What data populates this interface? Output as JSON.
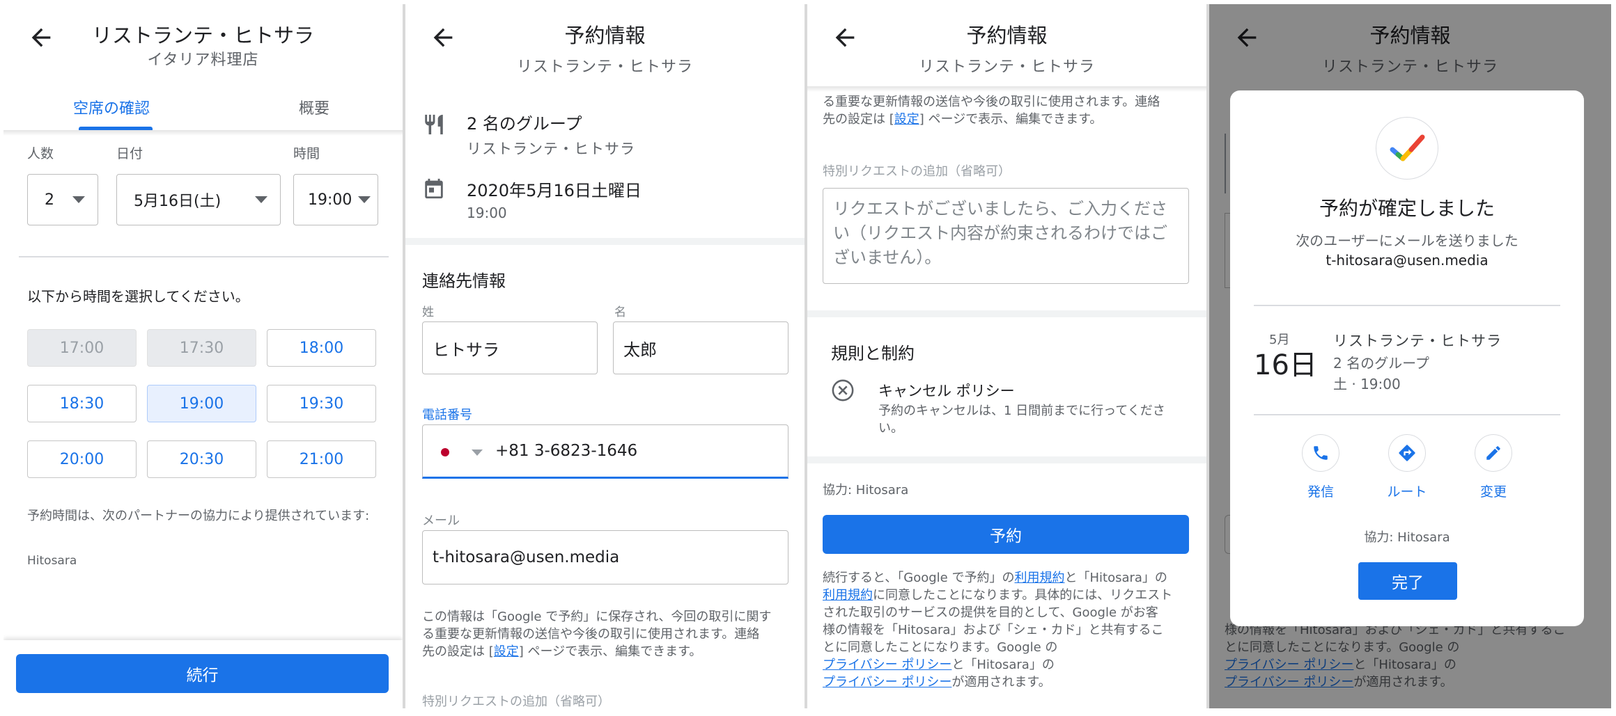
{
  "p1": {
    "title": "リストランテ・ヒトサラ",
    "subtitle": "イタリア料理店",
    "tabs": [
      "空席の確認",
      "概要"
    ],
    "labels": {
      "party": "人数",
      "date": "日付",
      "time": "時間"
    },
    "party_value": "2",
    "date_value": "5月16日(土)",
    "time_value": "19:00",
    "prompt": "以下から時間を選択してください。",
    "slots": [
      "17:00",
      "17:30",
      "18:00",
      "18:30",
      "19:00",
      "19:30",
      "20:00",
      "20:30",
      "21:00"
    ],
    "partner_note": "予約時間は、次のパートナーの協力により提供されています:",
    "partner": "Hitosara",
    "continue": "続行"
  },
  "p2": {
    "title": "予約情報",
    "subtitle": "リストランテ・ヒトサラ",
    "group": "2 名のグループ",
    "restaurant": "リストランテ・ヒトサラ",
    "date": "2020年5月16日土曜日",
    "time": "19:00",
    "contact_title": "連絡先情報",
    "last_name_label": "姓",
    "first_name_label": "名",
    "last_name": "ヒトサラ",
    "first_name": "太郎",
    "phone_label": "電話番号",
    "phone": "+81 3-6823-1646",
    "email_label": "メール",
    "email": "t-hitosara@usen.media",
    "info_1": "この情報は「Google で予約」に保存され、今回の取引に関す",
    "info_2": "る重要な更新情報の送信や今後の取引に使用されます。連絡",
    "info_3a": "先の設定は ",
    "info_link": "設定",
    "info_3b": " ページで表示、編集できます。",
    "special_label": "特別リクエストの追加（省略可）"
  },
  "p3": {
    "title": "予約情報",
    "subtitle": "リストランテ・ヒトサラ",
    "info_2": "る重要な更新情報の送信や今後の取引に使用されます。連絡",
    "info_3a": "先の設定は ",
    "info_link": "設定",
    "info_3b": " ページで表示、編集できます。",
    "special_label": "特別リクエストの追加（省略可）",
    "request_ph_1": "リクエストがございましたら、ご入力くださ",
    "request_ph_2": "い（リクエスト内容が約束されるわけではご",
    "request_ph_3": "ざいません）。",
    "rules_title": "規則と制約",
    "cancel_title": "キャンセル ポリシー",
    "cancel_1": "予約のキャンセルは、1 日間前までに行ってくださ",
    "cancel_2": "い。",
    "partner": "協力: Hitosara",
    "reserve": "予約",
    "terms_1a": "続行すると、「Google で予約」の",
    "terms_link1": "利用規約",
    "terms_1b": "と「Hitosara」の",
    "terms_link2": "利用規約",
    "terms_2b": "に同意したことになります。具体的には、リクエスト",
    "terms_3": "された取引のサービスの提供を目的として、Google がお客",
    "terms_4": "様の情報を「Hitosara」および「シェ・カド」と共有するこ",
    "terms_5": "とに同意したことになります。Google の",
    "terms_link3": "プライバシー ポリシー",
    "terms_6b": "と「Hitosara」の",
    "terms_link4": "プライバシー ポリシー",
    "terms_7b": "が適用されます。"
  },
  "p4": {
    "title": "予約情報",
    "subtitle": "リストランテ・ヒトサラ",
    "confirm_title": "予約が確定しました",
    "sent_to": "次のユーザーにメールを送りました",
    "email": "t-hitosara@usen.media",
    "month": "5月",
    "day": "16日",
    "restaurant": "リストランテ・ヒトサラ",
    "group": "2 名のグループ",
    "when": "土 · 19:00",
    "actions": [
      "発信",
      "ルート",
      "変更"
    ],
    "partner": "協力: Hitosara",
    "done": "完了",
    "bg_terms_4": "様の情報を「Hitosara」および「シェ・カド」と共有するこ",
    "bg_terms_5": "とに同意したことになります。Google の",
    "bg_link3": "プライバシー ポリシー",
    "bg_terms_6b": "と「Hitosara」の",
    "bg_link4": "プライバシー ポリシー",
    "bg_terms_7b": "が適用されます。"
  },
  "colors": {
    "accent": "#1a73e8",
    "disabled": "#e8eaed",
    "selected": "#e8f0fe"
  }
}
